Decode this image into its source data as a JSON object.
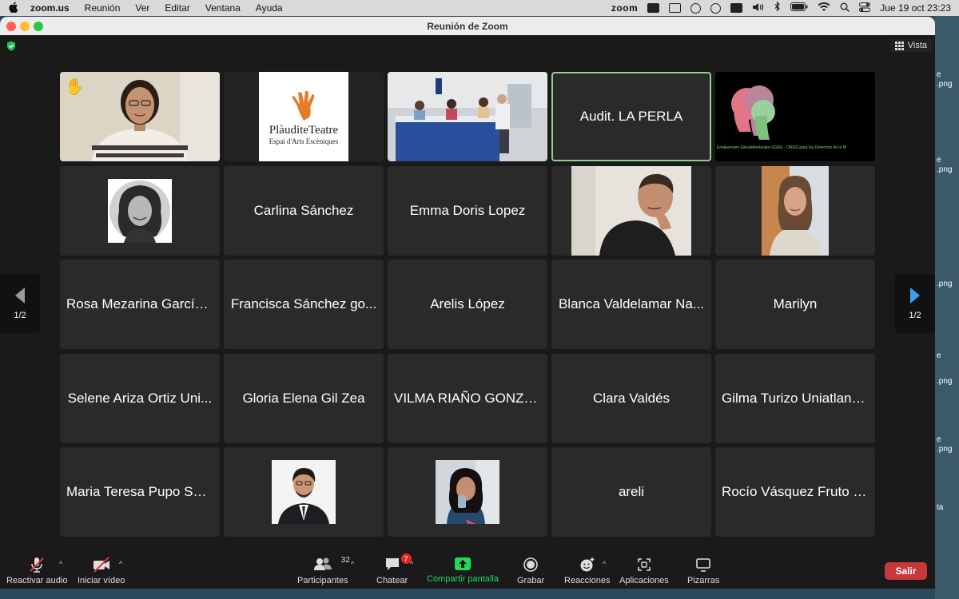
{
  "menubar": {
    "app_name": "zoom.us",
    "menus": [
      "Reunión",
      "Ver",
      "Editar",
      "Ventana",
      "Ayuda"
    ],
    "zoom_label": "zoom",
    "datetime": "Jue 19 oct  23:23"
  },
  "desktop_files": [
    ".png",
    "e",
    ".png",
    "e",
    ".png",
    "e",
    ".png",
    "e",
    ".png",
    "ta"
  ],
  "window": {
    "title": "Reunión de Zoom",
    "view_label": "Vista"
  },
  "tiles": [
    {
      "name": "",
      "kind": "video-raised-hand"
    },
    {
      "name": "",
      "kind": "logo-plauditeatre",
      "logo_main": "PlàuditeTeatre",
      "logo_sub": "Espai d'Arts Escèniques"
    },
    {
      "name": "",
      "kind": "video-room"
    },
    {
      "name": "Audit. LA PERLA",
      "kind": "active-name"
    },
    {
      "name": "",
      "kind": "logo-ggke",
      "caption": "Emakumeen Eskubideetarako GGKE - ONGD para los Derechos de la M"
    },
    {
      "name": "",
      "kind": "photo-woman-bw"
    },
    {
      "name": "Carlina Sánchez",
      "kind": "name"
    },
    {
      "name": "Emma Doris Lopez",
      "kind": "name"
    },
    {
      "name": "",
      "kind": "video-man"
    },
    {
      "name": "",
      "kind": "video-woman"
    },
    {
      "name": "Rosa Mezarina García...",
      "kind": "name"
    },
    {
      "name": "Francisca Sánchez go...",
      "kind": "name"
    },
    {
      "name": "Arelis López",
      "kind": "name"
    },
    {
      "name": "Blanca Valdelamar Na...",
      "kind": "name"
    },
    {
      "name": "Marilyn",
      "kind": "name"
    },
    {
      "name": "Selene Ariza Ortiz Uni...",
      "kind": "name"
    },
    {
      "name": "Gloria Elena Gil Zea",
      "kind": "name"
    },
    {
      "name": "VILMA RIAÑO GONZA...",
      "kind": "name"
    },
    {
      "name": "Clara Valdés",
      "kind": "name"
    },
    {
      "name": "Gilma Turizo Uniatlanti...",
      "kind": "name"
    },
    {
      "name": "Maria Teresa Pupo Sal...",
      "kind": "name"
    },
    {
      "name": "",
      "kind": "photo-man-suit"
    },
    {
      "name": "",
      "kind": "photo-woman-selfie"
    },
    {
      "name": "areli",
      "kind": "name"
    },
    {
      "name": "Rocío Vásquez Fruto U...",
      "kind": "name"
    }
  ],
  "pagination": {
    "left": "1/2",
    "right": "1/2"
  },
  "toolbar": {
    "unmute": "Reactivar audio",
    "start_video": "Iniciar vídeo",
    "participants": "Participantes",
    "participants_count": "32",
    "chat": "Chatear",
    "chat_badge": "7",
    "share": "Compartir pantalla",
    "record": "Grabar",
    "reactions": "Reacciones",
    "apps": "Aplicaciones",
    "whiteboards": "Pizarras",
    "leave": "Salir"
  },
  "colors": {
    "share_green": "#23d959",
    "leave_red": "#c7383a",
    "active_border": "#8ad58a",
    "nav_arrow_blue": "#3aa0f0"
  }
}
